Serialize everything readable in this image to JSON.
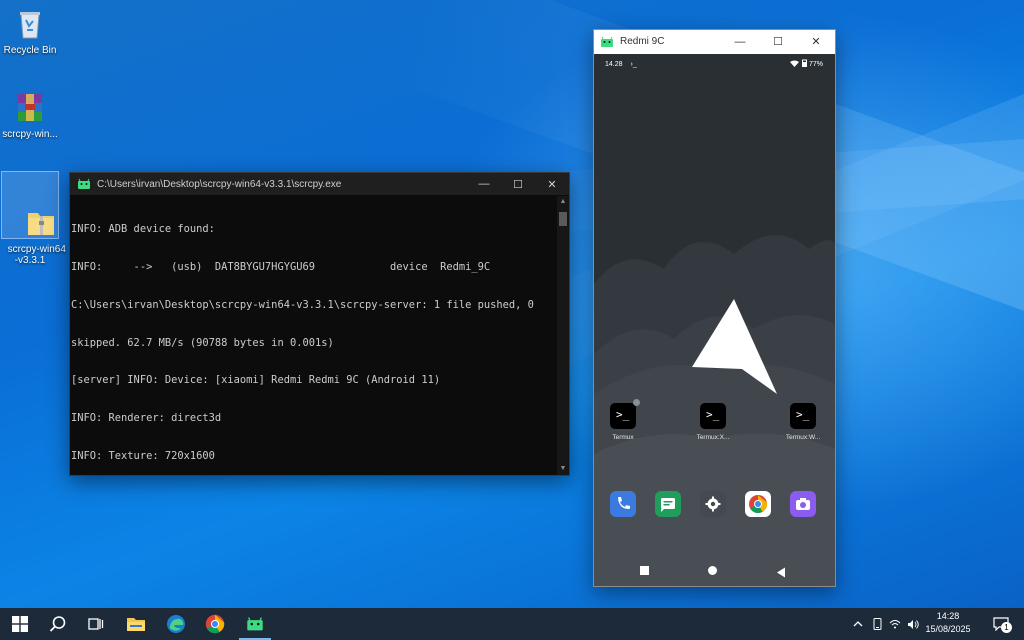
{
  "desktop": {
    "icons": [
      {
        "label": "Recycle Bin"
      },
      {
        "label": "scrcpy-win..."
      },
      {
        "label": "scrcpy-win64\n-v3.3.1"
      }
    ]
  },
  "console": {
    "title": "C:\\Users\\irvan\\Desktop\\scrcpy-win64-v3.3.1\\scrcpy.exe",
    "lines": [
      "INFO: ADB device found:",
      "INFO:     -->   (usb)  DAT8BYGU7HGYGU69            device  Redmi_9C",
      "C:\\Users\\irvan\\Desktop\\scrcpy-win64-v3.3.1\\scrcpy-server: 1 file pushed, 0",
      "skipped. 62.7 MB/s (90788 bytes in 0.001s)",
      "[server] INFO: Device: [xiaomi] Redmi Redmi 9C (Android 11)",
      "INFO: Renderer: direct3d",
      "INFO: Texture: 720x1600"
    ]
  },
  "phone": {
    "window_title": "Redmi 9C",
    "status": {
      "time": "14.28",
      "prompt": "›_",
      "battery": "77%"
    },
    "apps": [
      {
        "label": "Termux"
      },
      {
        "label": "Termux:X..."
      },
      {
        "label": "Termux:W..."
      }
    ],
    "dock": [
      {
        "icon": "phone-icon",
        "color": "#3b7be0"
      },
      {
        "icon": "messages-icon",
        "color": "#1e9e5a"
      },
      {
        "icon": "settings-icon",
        "color": "#444a50"
      },
      {
        "icon": "chrome-icon",
        "color": "#ffffff"
      },
      {
        "icon": "camera-icon",
        "color": "#8a5cf0"
      }
    ]
  },
  "taskbar": {
    "time": "14:28",
    "date": "15/08/2025",
    "notification_count": "1"
  }
}
